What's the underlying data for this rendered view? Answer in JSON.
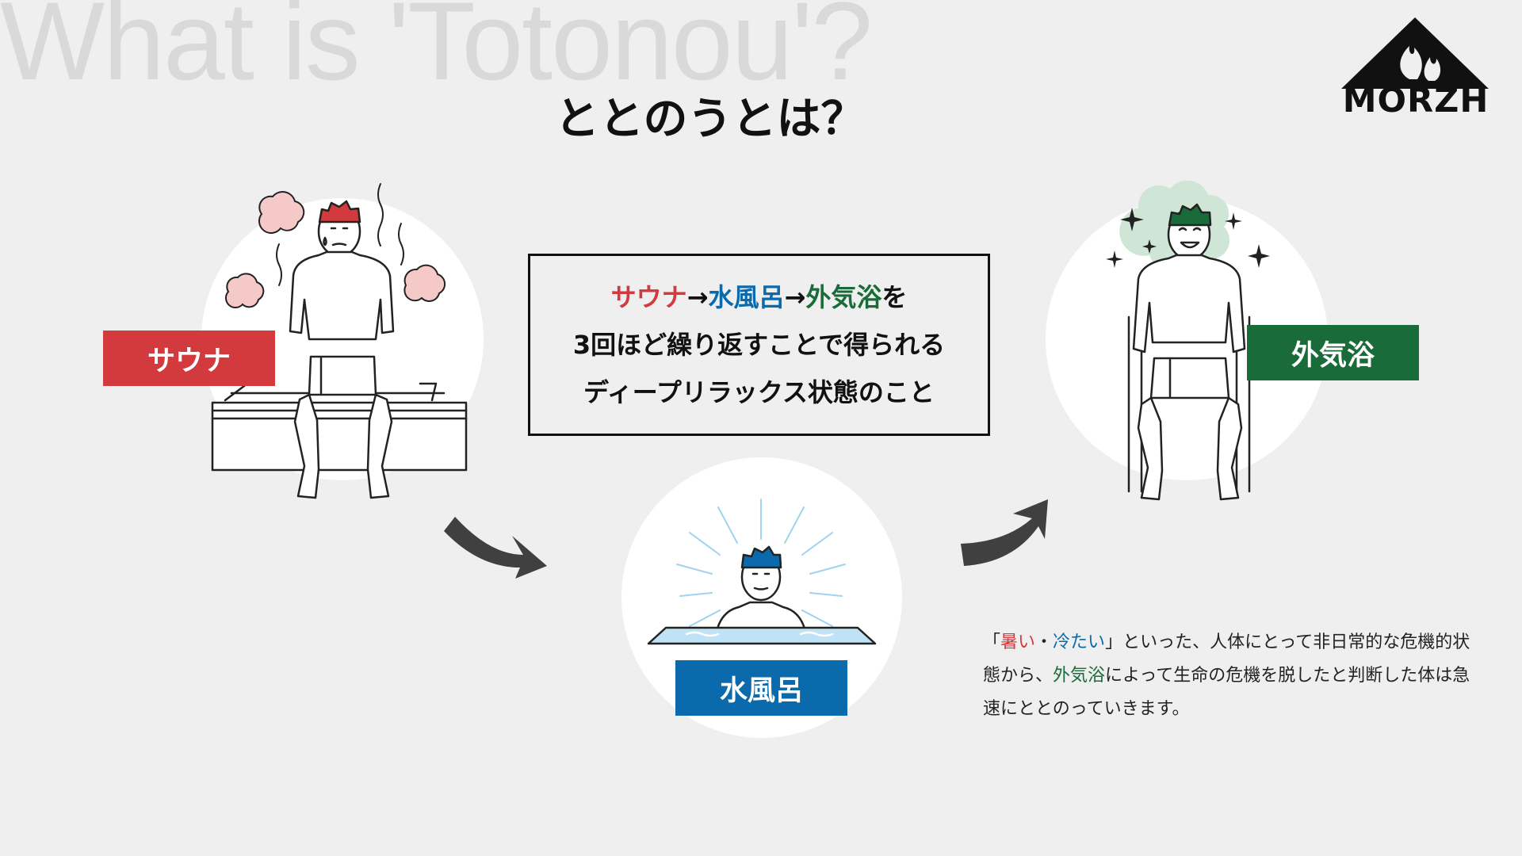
{
  "bg_title": "What is 'Totonou'?",
  "title": "ととのうとは？",
  "logo_text": "MORZH",
  "labels": {
    "sauna": "サウナ",
    "water": "水風呂",
    "air": "外気浴"
  },
  "definition": {
    "line1": {
      "sauna": "サウナ",
      "arrow1": "→",
      "water": "水風呂",
      "arrow2": "→",
      "air": "外気浴",
      "tail": "を"
    },
    "line2": "3回ほど繰り返すことで得られる",
    "line3": "ディープリラックス状態のこと"
  },
  "description": {
    "open": "「",
    "hot": "暑い",
    "dot": "・",
    "cold": "冷たい",
    "part1": "」といった、人体にとって非日常的な危機的状態から、",
    "air": "外気浴",
    "part2": "によって生命の危機を脱したと判断した体は急速にととのっていきます。"
  },
  "colors": {
    "sauna": "#d33a3e",
    "water": "#0a6aab",
    "air": "#1a6b3a",
    "background": "#efefef"
  },
  "icons": [
    "steam-cloud-icon",
    "sparkle-icon",
    "flow-arrow-icon",
    "mountain-flame-logo-icon"
  ]
}
